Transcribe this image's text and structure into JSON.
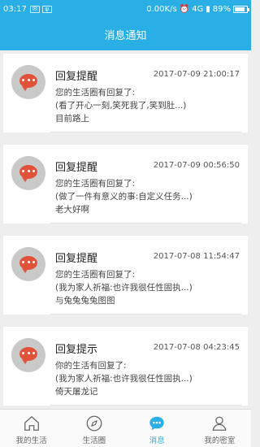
{
  "status_bar": {
    "time": "03:17",
    "net_speed": "0.00K/s",
    "signal_text": "4G",
    "battery_text": "89%",
    "battery_level": 0.89
  },
  "header": {
    "title": "消息通知"
  },
  "messages": [
    {
      "title": "回复提醒",
      "time": "2017-07-09 21:00:17",
      "line1": "您的生活圈有回复了:",
      "line2": "(看了开心一刻,笑死我了,笑到肚...)",
      "line3": "目前路上"
    },
    {
      "title": "回复提醒",
      "time": "2017-07-09 00:56:50",
      "line1": "您的生活圈有回复了:",
      "line2": "(做了一件有意义的事:自定义任务...)",
      "line3": "老大好啊"
    },
    {
      "title": "回复提醒",
      "time": "2017-07-08 11:54:47",
      "line1": "您的生活圈有回复了:",
      "line2": "(我为家人祈福:也许我很任性固执...)",
      "line3": "与兔兔兔兔图图"
    },
    {
      "title": "回复提示",
      "time": "2017-07-08 04:23:45",
      "line1": "你的生活有回复了:",
      "line2": "(我为家人祈福:也许我很任性固执...)",
      "line3": "倚天屠龙记"
    }
  ],
  "tabs": [
    {
      "label": "我的生活",
      "icon": "home-icon"
    },
    {
      "label": "生活圈",
      "icon": "compass-icon"
    },
    {
      "label": "消息",
      "icon": "message-icon",
      "active": true
    },
    {
      "label": "我的密室",
      "icon": "person-icon"
    }
  ],
  "colors": {
    "primary": "#29aee6",
    "avatar_bubble": "#e0533a"
  }
}
